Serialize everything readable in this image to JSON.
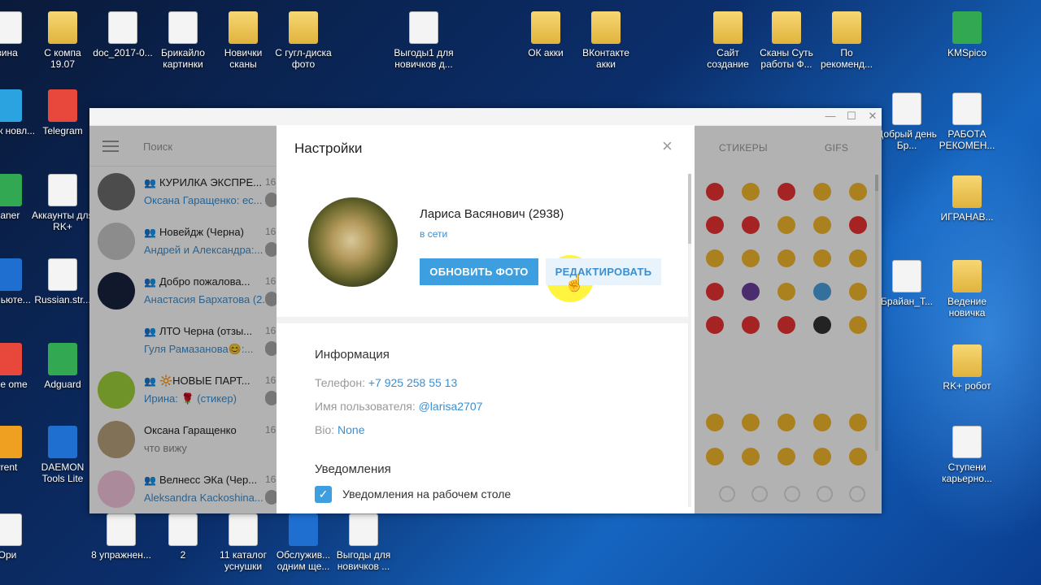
{
  "desktop": {
    "top_row": [
      {
        "label": "зина",
        "kind": "file"
      },
      {
        "label": "С компа 19.07",
        "kind": "folder"
      },
      {
        "label": "doc_2017-0...",
        "kind": "file"
      },
      {
        "label": "Брикайло картинки",
        "kind": "file"
      },
      {
        "label": "Новички сканы",
        "kind": "folder"
      },
      {
        "label": "С гугл-диска фото",
        "kind": "folder"
      },
      {
        "label": "Выгоды1 для новичков д...",
        "kind": "file"
      },
      {
        "label": "ОК акки",
        "kind": "folder"
      },
      {
        "label": "ВКонтакте акки",
        "kind": "folder"
      },
      {
        "label": "Сайт создание",
        "kind": "folder"
      },
      {
        "label": "Сканы Суть работы Ф...",
        "kind": "folder"
      },
      {
        "label": "По рекоменд...",
        "kind": "folder"
      },
      {
        "label": "KMSpico",
        "kind": "app"
      }
    ],
    "left_column": [
      {
        "label": "щник новл...",
        "kind": "app"
      },
      {
        "label": "Telegram",
        "kind": "app"
      },
      {
        "label": "eaner",
        "kind": "app"
      },
      {
        "label": "Аккаунты для RK+",
        "kind": "file"
      },
      {
        "label": "тот ьюте...",
        "kind": "app"
      },
      {
        "label": "Russian.str...",
        "kind": "file"
      },
      {
        "label": "ogle ome",
        "kind": "app"
      },
      {
        "label": "Adguard",
        "kind": "app"
      },
      {
        "label": "rrent",
        "kind": "app"
      },
      {
        "label": "DAEMON Tools Lite",
        "kind": "app"
      }
    ],
    "right_column": [
      {
        "label": "Добрый день Бр...",
        "kind": "file"
      },
      {
        "label": "РАБОТА РЕКОМЕН...",
        "kind": "file"
      },
      {
        "label": "ИГРАНАВ...",
        "kind": "folder"
      },
      {
        "label": "Брайан_Т...",
        "kind": "file"
      },
      {
        "label": "Ведение новичка",
        "kind": "folder"
      },
      {
        "label": "RK+ робот",
        "kind": "folder"
      },
      {
        "label": "Ступени карьерно...",
        "kind": "file"
      }
    ],
    "bottom_row": [
      {
        "label": "Ори",
        "kind": "file"
      },
      {
        "label": "8 упражнен...",
        "kind": "file"
      },
      {
        "label": "2",
        "kind": "file"
      },
      {
        "label": "11 каталог уснушки",
        "kind": "file"
      },
      {
        "label": "Обслужив... одним ще...",
        "kind": "app"
      },
      {
        "label": "Выгоды для новичков ...",
        "kind": "file"
      }
    ]
  },
  "telegram": {
    "search_placeholder": "Поиск",
    "chats": [
      {
        "name": "КУРИЛКА ЭКСПРЕ...",
        "preview": "Оксана Гаращенко: ес...",
        "time": "16",
        "group": true
      },
      {
        "name": "Новейдж (Черна)",
        "preview": "Андрей и Александра:...",
        "time": "16",
        "group": true
      },
      {
        "name": "Добро пожалова...",
        "preview": "Анастасия Бархатова (2...",
        "time": "16",
        "group": true
      },
      {
        "name": "ЛТО Черна (отзы...",
        "preview": "Гуля Рамазанова😊:...",
        "time": "16",
        "group": true
      },
      {
        "name": "🔆НОВЫЕ ПАРТ...",
        "preview": "Ирина: 🌹 (стикер)",
        "time": "16",
        "group": true
      },
      {
        "name": "Оксана Гаращенко",
        "preview": "что вижу",
        "time": "16",
        "group": false
      },
      {
        "name": "Велнесс ЭКа (Чер...",
        "preview": "Aleksandra Kackoshina...",
        "time": "16",
        "group": true
      }
    ],
    "right_tabs": [
      "СТИКЕРЫ",
      "GIFS"
    ],
    "window_controls": [
      "—",
      "☐",
      "✕"
    ]
  },
  "settings": {
    "title": "Настройки",
    "close": "×",
    "profile": {
      "name": "Лариса Васянович (2938)",
      "status": "в сети",
      "update_photo": "ОБНОВИТЬ ФОТО",
      "edit": "РЕДАКТИРОВАТЬ"
    },
    "info": {
      "heading": "Информация",
      "phone_label": "Телефон:",
      "phone_value": "+7 925 258 55 13",
      "username_label": "Имя пользователя:",
      "username_value": "@larisa2707",
      "bio_label": "Bio:",
      "bio_value": "None"
    },
    "notifications": {
      "heading": "Уведомления",
      "desktop_label": "Уведомления на рабочем столе",
      "desktop_checked": true
    }
  },
  "colors": {
    "accent": "#3d9ee0",
    "link": "#3b8fd0",
    "cursor_highlight": "#fff000"
  }
}
